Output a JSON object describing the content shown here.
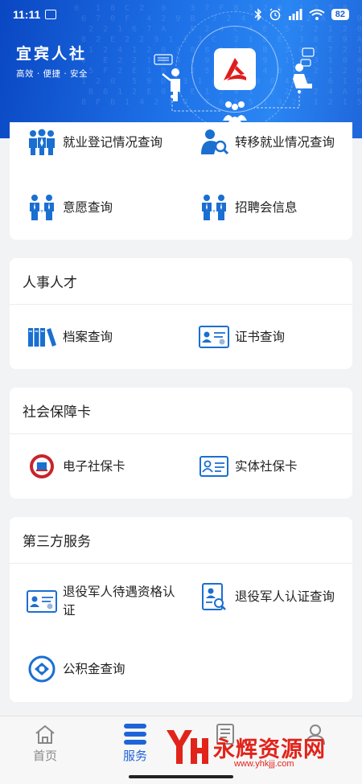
{
  "status_bar": {
    "time": "11:11",
    "battery": "82"
  },
  "header": {
    "app_name": "宜宾人社",
    "slogan": "高效 · 便捷 · 安全"
  },
  "sections": {
    "employment": {
      "items": [
        {
          "label": "就业登记情况查询",
          "icon": "people-group-icon"
        },
        {
          "label": "转移就业情况查询",
          "icon": "person-search-icon"
        },
        {
          "label": "意愿查询",
          "icon": "people-pair-icon"
        },
        {
          "label": "招聘会信息",
          "icon": "people-pair-icon"
        }
      ]
    },
    "personnel": {
      "title": "人事人才",
      "items": [
        {
          "label": "档案查询",
          "icon": "binders-icon"
        },
        {
          "label": "证书查询",
          "icon": "certificate-icon"
        }
      ]
    },
    "social_card": {
      "title": "社会保障卡",
      "items": [
        {
          "label": "电子社保卡",
          "icon": "social-card-seal-icon"
        },
        {
          "label": "实体社保卡",
          "icon": "id-card-icon"
        }
      ]
    },
    "third_party": {
      "title": "第三方服务",
      "items": [
        {
          "label": "退役军人待遇资格认证",
          "icon": "veteran-certificate-icon"
        },
        {
          "label": "退役军人认证查询",
          "icon": "document-search-icon"
        },
        {
          "label": "公积金查询",
          "icon": "housing-fund-icon"
        }
      ]
    }
  },
  "tabbar": {
    "tabs": [
      {
        "label": "首页",
        "icon": "home-icon",
        "active": false
      },
      {
        "label": "服务",
        "icon": "menu-icon",
        "active": true
      },
      {
        "label": "",
        "icon": "news-icon",
        "active": false
      },
      {
        "label": "",
        "icon": "user-icon",
        "active": false
      }
    ]
  },
  "watermark": {
    "text": "永辉资源网",
    "url": "www.yhkjjj.com"
  },
  "colors": {
    "brand_blue": "#1e64d8",
    "icon_blue": "#1a6fd1",
    "watermark_red": "#e2231a"
  }
}
